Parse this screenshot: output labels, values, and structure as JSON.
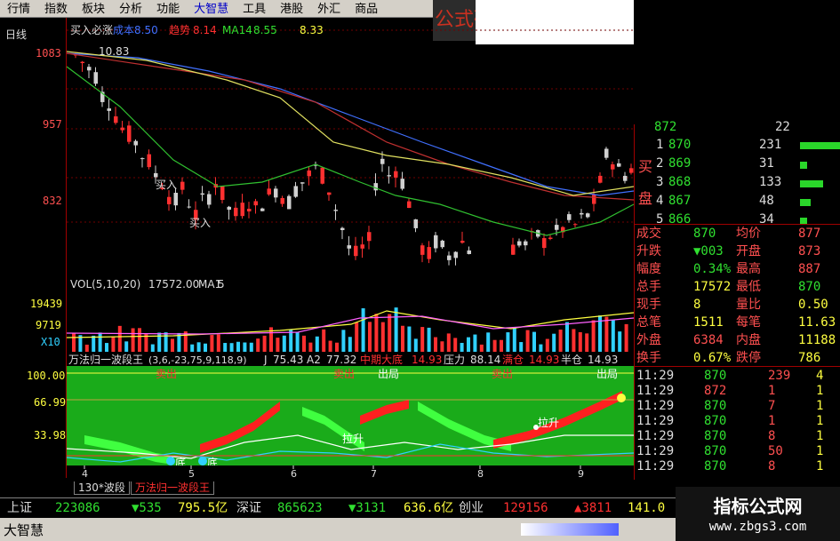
{
  "menu": [
    "行情",
    "指数",
    "板块",
    "分析",
    "功能",
    "大智慧",
    "工具",
    "港股",
    "外汇",
    "商品"
  ],
  "menu_accent": "大智慧",
  "banner": "公式砭",
  "chart": {
    "period": "日线",
    "ma_title": "买入必涨",
    "ma_cost": "成本",
    "ma_cost_val": "8.50",
    "ma_trend": "趋势",
    "ma_trend_val": "8.14",
    "ma14": "MA14",
    "ma14_val": "8.55",
    "ma_last_val": "8.33",
    "price_high": "1083",
    "price_mid": "957",
    "price_low": "832",
    "peak_label": "10.83",
    "buy_label": "买入",
    "vol_title": "VOL(5,10,20)",
    "vol_val": "17572.00",
    "vol_ma": "MA1",
    "vol_ma_val": "5",
    "vol_high": "19439",
    "vol_mid": "9719",
    "vol_unit": "X10",
    "ind_title": "万法归一波段王",
    "ind_params": "(3,6,-23,75,9,118,9)",
    "ind_j": "J",
    "ind_j_val": "75.43",
    "ind_a2": "A2",
    "ind_a2_val": "77.32",
    "ind_bottom": "中期大底",
    "ind_bottom_val": "14.93",
    "ind_press": "压力",
    "ind_press_val": "88.14",
    "ind_full": "满仓",
    "ind_full_val": "14.93",
    "ind_half": "半仓",
    "ind_half_val": "14.93",
    "ind_y_high": "100.00",
    "ind_y_mid": "66.99",
    "ind_y_low": "33.98",
    "signal_lift": "拉升",
    "signal_bottom": "底",
    "signal_sell": "卖出",
    "signal_blow": "出局",
    "month_labels": [
      "4",
      "5",
      "6",
      "7",
      "8",
      "9"
    ]
  },
  "orderbook": {
    "top_partial": [
      "872",
      "22"
    ],
    "buy_label_1": "买",
    "buy_label_2": "盘",
    "rows": [
      {
        "idx": "1",
        "price": "870",
        "vol": "231"
      },
      {
        "idx": "2",
        "price": "869",
        "vol": "31"
      },
      {
        "idx": "3",
        "price": "868",
        "vol": "133"
      },
      {
        "idx": "4",
        "price": "867",
        "vol": "48"
      },
      {
        "idx": "5",
        "price": "866",
        "vol": "34"
      }
    ]
  },
  "quote": [
    {
      "l": "成交",
      "v1": "870",
      "m": "均价",
      "v2": "877"
    },
    {
      "l": "升跌",
      "v1": "▼003",
      "m": "开盘",
      "v2": "873"
    },
    {
      "l": "幅度",
      "v1": "0.34%",
      "m": "最高",
      "v2": "887"
    },
    {
      "l": "总手",
      "v1": "17572",
      "m": "最低",
      "v2": "870"
    },
    {
      "l": "现手",
      "v1": "8",
      "m": "量比",
      "v2": "0.50"
    },
    {
      "l": "总笔",
      "v1": "1511",
      "m": "每笔",
      "v2": "11.63"
    },
    {
      "l": "外盘",
      "v1": "6384",
      "m": "内盘",
      "v2": "11188"
    },
    {
      "l": "换手",
      "v1": "0.67%",
      "m": "跌停",
      "v2": "786"
    }
  ],
  "ticks": [
    {
      "t": "11:29",
      "p": "870",
      "v": "239",
      "n": "4"
    },
    {
      "t": "11:29",
      "p": "872",
      "v": "1",
      "n": "1"
    },
    {
      "t": "11:29",
      "p": "870",
      "v": "7",
      "n": "1"
    },
    {
      "t": "11:29",
      "p": "870",
      "v": "1",
      "n": "1"
    },
    {
      "t": "11:29",
      "p": "870",
      "v": "8",
      "n": "1"
    },
    {
      "t": "11:29",
      "p": "870",
      "v": "50",
      "n": "1"
    },
    {
      "t": "11:29",
      "p": "870",
      "v": "8",
      "n": "1"
    }
  ],
  "tabs": {
    "tab1": "130*波段",
    "tab2": "万法归一波段王"
  },
  "status": {
    "sh_label": "上证",
    "sh_val": "223086",
    "sh_chg": "▼535",
    "sh_amt": "795.5亿",
    "sz_label": "深证",
    "sz_val": "865623",
    "sz_chg": "▼3131",
    "sz_amt": "636.6亿",
    "cy_label": "创业",
    "cy_val": "129156",
    "cy_chg": "▲3811",
    "cy_amt": "141.0",
    "brand_label": "大智慧"
  },
  "watermark": {
    "title": "指标公式网",
    "url": "www.zbgs3.com"
  },
  "colors": {
    "up": "#ff3030",
    "down": "#30d0ff",
    "yellow": "#ffff40",
    "green": "#2ad72a"
  }
}
